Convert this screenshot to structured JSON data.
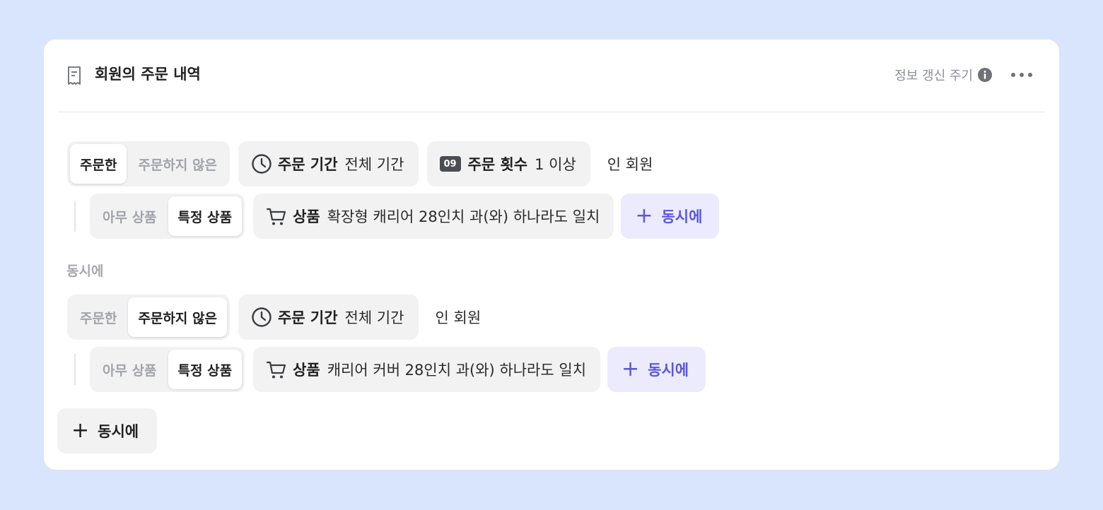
{
  "card": {
    "title": "회원의 주문 내역",
    "refresh_label": "정보 갱신 주기",
    "title_icon": "receipt-icon",
    "info_icon": "info-icon",
    "more_icon": "more-horizontal-icon"
  },
  "groups": [
    {
      "order_toggle": {
        "options": [
          "주문한",
          "주문하지 않은"
        ],
        "selected": "주문한"
      },
      "period": {
        "label": "주문 기간",
        "value": "전체 기간",
        "icon": "clock-icon"
      },
      "count": {
        "badge": "09",
        "label": "주문 횟수",
        "value": "1 이상",
        "icon": "number-badge-icon"
      },
      "suffix": "인 회원",
      "product_toggle": {
        "options": [
          "아무 상품",
          "특정 상품"
        ],
        "selected": "특정 상품"
      },
      "product": {
        "label": "상품",
        "value": "확장형 캐리어 28인치 과(와) 하나라도 일치",
        "icon": "cart-icon"
      },
      "add_label": "동시에"
    },
    {
      "order_toggle": {
        "options": [
          "주문한",
          "주문하지 않은"
        ],
        "selected": "주문하지 않은"
      },
      "period": {
        "label": "주문 기간",
        "value": "전체 기간",
        "icon": "clock-icon"
      },
      "suffix": "인 회원",
      "product_toggle": {
        "options": [
          "아무 상품",
          "특정 상품"
        ],
        "selected": "특정 상품"
      },
      "product": {
        "label": "상품",
        "value": "캐리어 커버 28인치 과(와) 하나라도 일치",
        "icon": "cart-icon"
      },
      "add_label": "동시에"
    }
  ],
  "connector_label": "동시에",
  "add_group_label": "동시에",
  "colors": {
    "background": "#d9e5fd",
    "accent": "#5a55e0",
    "accent_bg": "#ecebfd",
    "chip_bg": "#f2f2f3"
  }
}
